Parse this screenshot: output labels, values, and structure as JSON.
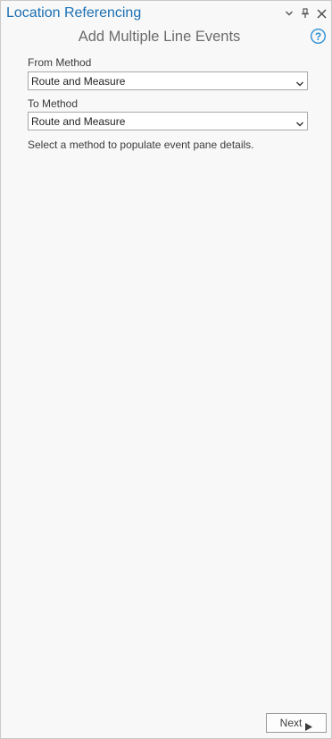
{
  "pane": {
    "title": "Location Referencing",
    "subtitle": "Add Multiple Line Events"
  },
  "header_controls": {
    "options_icon": "chevron-down-icon",
    "pin_icon": "pin-icon",
    "close_icon": "close-icon"
  },
  "help": {
    "icon": "question-circle-icon",
    "symbol": "?"
  },
  "form": {
    "from_method": {
      "label": "From Method",
      "selected": "Route and Measure"
    },
    "to_method": {
      "label": "To Method",
      "selected": "Route and Measure"
    },
    "hint": "Select a method to populate event pane details."
  },
  "footer": {
    "next_label": "Next",
    "next_icon": "play-arrow-icon"
  },
  "colors": {
    "title": "#1a6fb3",
    "help": "#2b8fd6",
    "background": "#f8f8f8"
  }
}
